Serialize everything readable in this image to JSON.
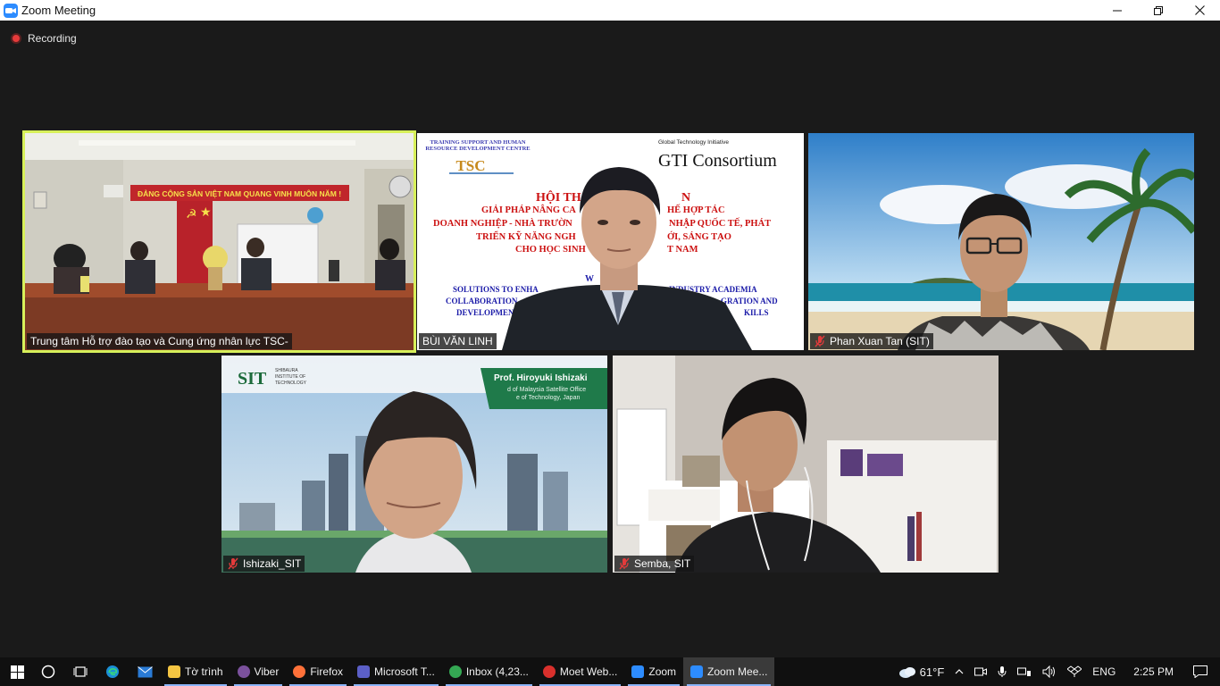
{
  "window": {
    "title": "Zoom Meeting"
  },
  "recording": {
    "label": "Recording"
  },
  "participants": [
    {
      "name": "Trung tâm Hỗ trợ đào tạo và Cung ứng nhân lực TSC-",
      "muted": false,
      "active": true
    },
    {
      "name": "BÙI VĂN LINH",
      "muted": false,
      "active": false
    },
    {
      "name": "Phan Xuan Tan (SIT)",
      "muted": true,
      "active": false
    },
    {
      "name": "Ishizaki_SIT",
      "muted": true,
      "active": false
    },
    {
      "name": "Semba, SIT",
      "muted": true,
      "active": false
    }
  ],
  "slide": {
    "org_header_1": "TRAINING SUPPORT AND HUMAN",
    "org_header_2": "RESOURCE DEVELOPMENT CENTRE",
    "logo_text": "TSC",
    "gti_small": "Global Technology Initiative",
    "gti_big": "GTI Consortium",
    "title_vn_1": "HỘI TH",
    "title_vn_1b": "N",
    "line_vn_2a": "GIẢI PHÁP NÂNG CA",
    "line_vn_2b": "HẾ HỢP TÁC",
    "line_vn_3a": "DOANH NGHIỆP - NHÀ TRƯỜN",
    "line_vn_3b": "NHẬP QUỐC TẾ, PHÁT",
    "line_vn_4a": "TRIỂN KỸ NĂNG NGH",
    "line_vn_4b": "ỚI, SÁNG TẠO",
    "line_vn_5a": "CHO HỌC SINH",
    "line_vn_5b": "T NAM",
    "line_w": "W",
    "line_en_1a": "SOLUTIONS TO ENHA",
    "line_en_1b": "INDUSTRY ACADEMIA",
    "line_en_2a": "COLLABORATION",
    "line_en_2b": "GRATION AND",
    "line_en_3a": "DEVELOPMEN",
    "line_en_3b": "KILLS"
  },
  "banner_ishizaki": {
    "logo": "SIT",
    "logo_sub_1": "SHIBAURA",
    "logo_sub_2": "INSTITUTE OF",
    "logo_sub_3": "TECHNOLOGY",
    "name": "Prof. Hiroyuki Ishizaki",
    "sub_1": "d of Malaysia Satellite Office",
    "sub_2": "e of Technology, Japan"
  },
  "wall_banner": "ĐẢNG CỘNG SẢN VIỆT NAM QUANG VINH MUÔN NĂM !",
  "taskbar": {
    "apps": [
      {
        "label": "Tờ trình",
        "color": "#f4c542",
        "running": true,
        "current": false
      },
      {
        "label": "Viber",
        "color": "#7b519d",
        "running": true,
        "current": false
      },
      {
        "label": "Firefox",
        "color": "#ff7139",
        "running": true,
        "current": false
      },
      {
        "label": "Microsoft T...",
        "color": "#5b5fc7",
        "running": true,
        "current": false
      },
      {
        "label": "Inbox (4,23...",
        "color": "#34a853",
        "running": true,
        "current": false
      },
      {
        "label": "Moet Web...",
        "color": "#d9302c",
        "running": true,
        "current": false
      },
      {
        "label": "Zoom",
        "color": "#2d8cff",
        "running": true,
        "current": false
      },
      {
        "label": "Zoom Mee...",
        "color": "#2d8cff",
        "running": true,
        "current": true
      }
    ],
    "weather": "61°F",
    "language": "ENG",
    "time": "2:25 PM"
  }
}
